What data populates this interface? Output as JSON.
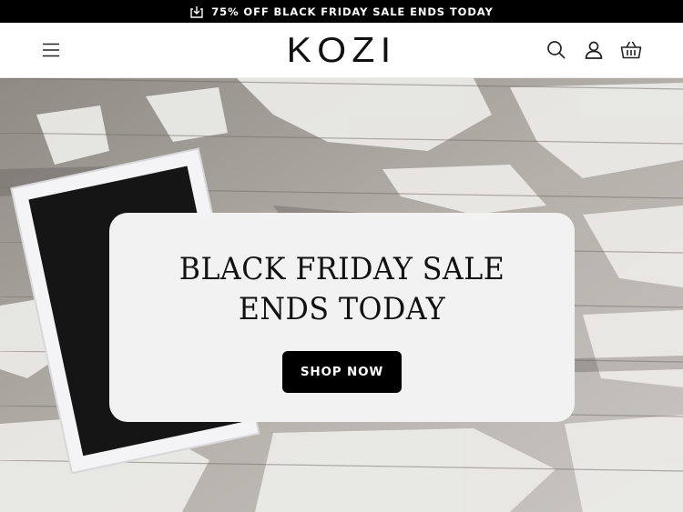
{
  "announcement": {
    "text": "75% OFF BLACK FRIDAY SALE ENDS TODAY",
    "icon": "download-tray-icon"
  },
  "header": {
    "logo": "KOZI",
    "menu_icon": "hamburger-menu-icon",
    "search_icon": "search-icon",
    "account_icon": "user-icon",
    "cart_icon": "basket-icon"
  },
  "hero": {
    "title_line1": "BLACK FRIDAY SALE",
    "title_line2": "ENDS TODAY",
    "cta_label": "SHOP NOW"
  },
  "colors": {
    "bar": "#000000",
    "card": "#f3f2f2",
    "button": "#000000"
  }
}
